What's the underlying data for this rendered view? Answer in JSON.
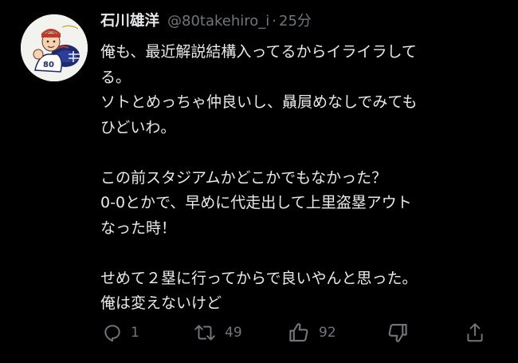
{
  "tweet": {
    "author_name": "石川雄洋",
    "handle": "@80takehiro_i",
    "separator": "·",
    "time": "25分",
    "lines": [
      "俺も、最近解説結構入ってるからイライラして",
      "る。",
      "ソトとめっちゃ仲良いし、贔屓めなしでみても",
      "ひどいわ。",
      "",
      "この前スタジアムかどこかでもなかった？",
      "0-0とかで、早めに代走出して上里盗塁アウト",
      "なった時！",
      "",
      "せめて２塁に行ってからで良いやんと思った。",
      "俺は変えないけど"
    ]
  },
  "actions": {
    "reply_icon": "reply-icon",
    "reply_count": "1",
    "retweet_icon": "retweet-icon",
    "retweet_count": "49",
    "like_icon": "thumbs-up-icon",
    "like_count": "92",
    "dislike_icon": "thumbs-down-icon",
    "share_icon": "share-icon"
  },
  "colors": {
    "background": "#000000",
    "primary_text": "#e7e9ea",
    "secondary_text": "#71767b"
  }
}
